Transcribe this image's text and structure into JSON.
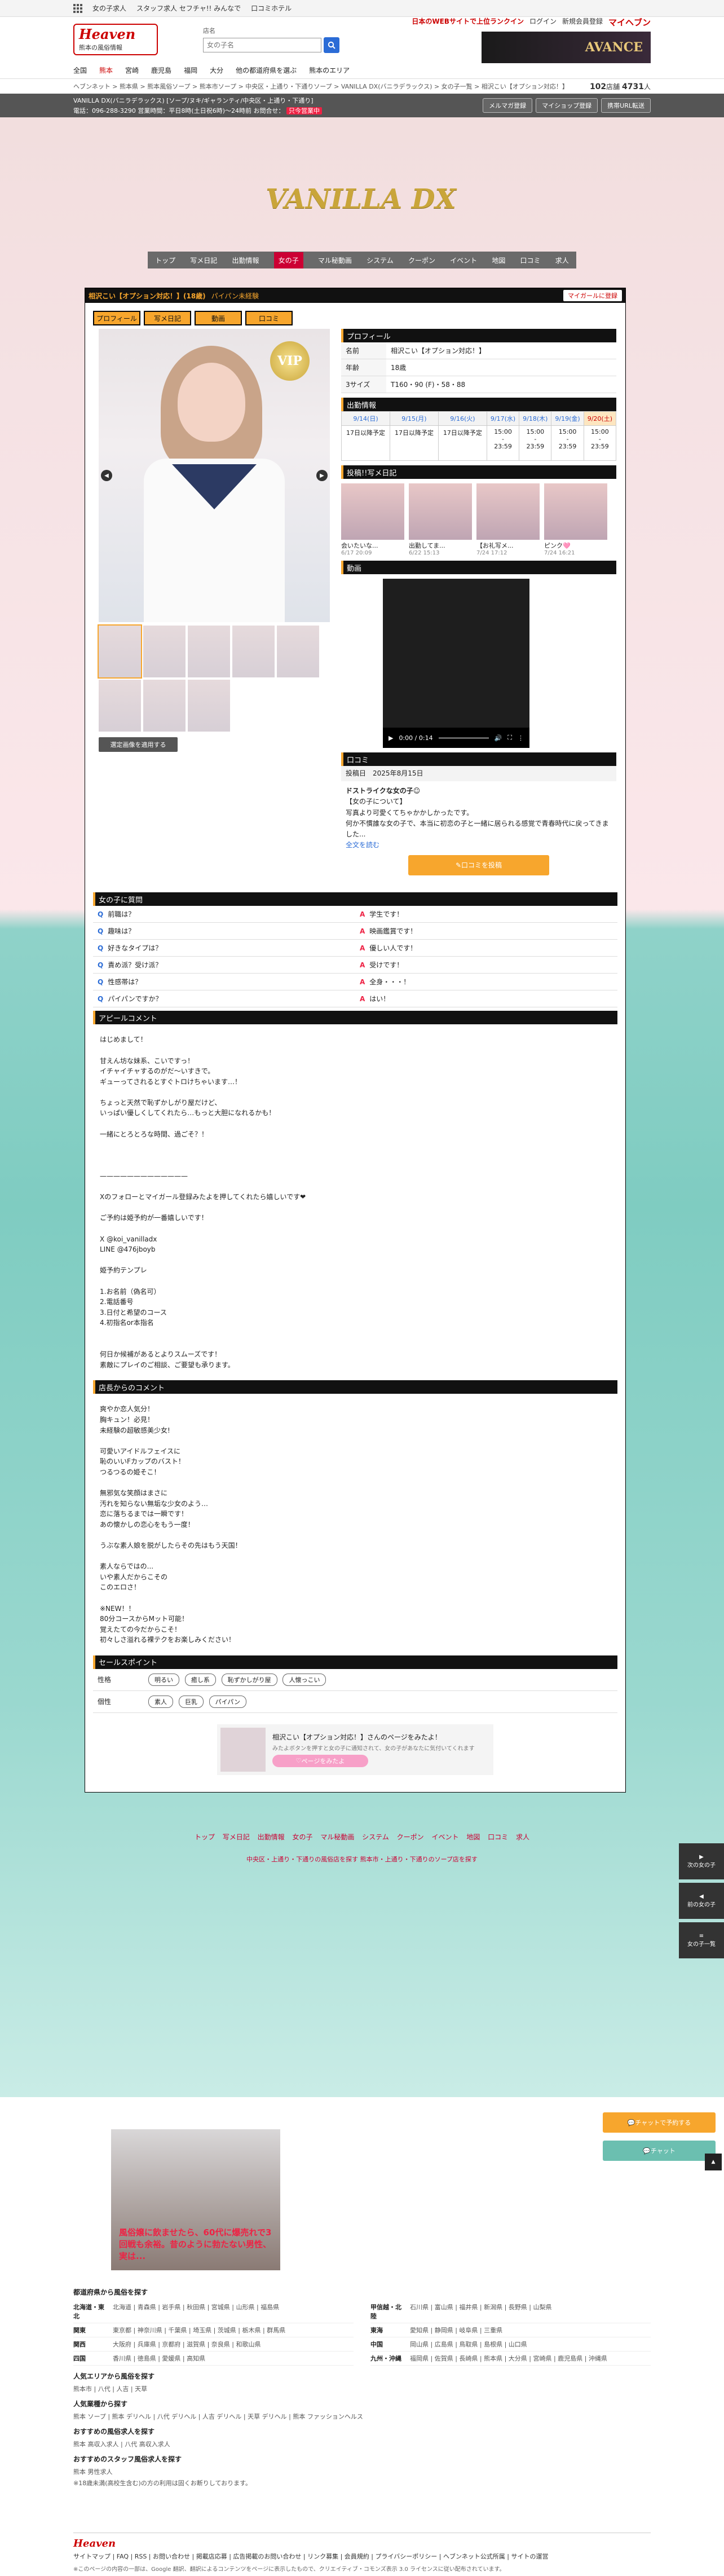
{
  "topbar": [
    "女の子求人",
    "スタッフ求人 セフチャ!! みんなで",
    "口コミホテル"
  ],
  "header": {
    "logo_main": "Heaven",
    "logo_area": "熊本の風俗情報",
    "search_label": "店名",
    "search_placeholder": "女の子名",
    "links": [
      "日本のWEBサイトで上位ランクイン",
      "ログイン",
      "新規会員登録"
    ],
    "my_heaven": "マイヘブン",
    "banner_text": "AVANCE"
  },
  "region_nav": [
    "全国",
    "熊本",
    "宮崎",
    "鹿児島",
    "福岡",
    "大分",
    "他の都道府県を選ぶ",
    "熊本のエリア"
  ],
  "breadcrumb": "ヘブンネット > 熊本県 > 熊本風俗ソープ > 熊本市ソープ > 中央区・上通り・下通りソープ > VANILLA DX(バニラデラックス) > 女の子一覧 > 相沢こい【オプション対応！】",
  "counts": {
    "shops": "102",
    "shops_unit": "店舗",
    "girls": "4731",
    "girls_unit": "人"
  },
  "shopbar": {
    "line1": "VANILLA DX(バニラデラックス) [ソープ/ヌキ/ギャランティ/中央区・上通り・下通り]",
    "line2": "電話：096-288-3290 営業時間：平日8時(土日祝6時)〜24時前 お問合せ：",
    "open_label": "只今営業中",
    "buttons": [
      "メルマガ登録",
      "マイショップ登録",
      "携帯URL転送"
    ]
  },
  "brand": "VANILLA DX",
  "shop_menu": [
    "トップ",
    "写メ日記",
    "出勤情報",
    "女の子",
    "マル秘動画",
    "システム",
    "クーポン",
    "イベント",
    "地図",
    "口コミ",
    "求人"
  ],
  "shop_menu_active": "女の子",
  "girl": {
    "name": "相沢こい【オプション対応！】(18歳)",
    "tag": "パイパン未経験",
    "fav": "マイガールに登録",
    "tabs": [
      "プロフィール",
      "写メ日記",
      "動画",
      "口コミ"
    ],
    "vip": "VIP",
    "apply": "選定画像を適用する"
  },
  "profile": {
    "title": "プロフィール",
    "rows": [
      {
        "k": "名前",
        "v": "相沢こい【オプション対応！】"
      },
      {
        "k": "年齢",
        "v": "18歳"
      },
      {
        "k": "3サイズ",
        "v": "T160・90 (F)・58・88"
      }
    ]
  },
  "schedule": {
    "title": "出勤情報",
    "days": [
      "9/14(日)",
      "9/15(月)",
      "9/16(火)",
      "9/17(水)",
      "9/18(木)",
      "9/19(金)",
      "9/20(土)"
    ],
    "times": [
      "17日以降予定",
      "17日以降予定",
      "17日以降予定",
      "15:00\n-\n23:59",
      "15:00\n-\n23:59",
      "15:00\n-\n23:59",
      "15:00\n-\n23:59"
    ]
  },
  "diary": {
    "title": "投稿!!写メ日記",
    "items": [
      {
        "cap": "会いたいな...",
        "date": "6/17 20:09"
      },
      {
        "cap": "出勤してま...",
        "date": "6/22 15:13"
      },
      {
        "cap": "【お礼写メ...",
        "date": "7/24 17:12"
      },
      {
        "cap": "ピンク🩷",
        "date": "7/24 16:21"
      }
    ]
  },
  "video": {
    "title": "動画",
    "time": "0:00 / 0:14"
  },
  "review": {
    "title": "口コミ",
    "date_label": "投稿日",
    "date": "2025年8月15日",
    "headline": "ドストライクな女の子☺",
    "subhead": "【女の子について】",
    "body": "写真より可愛くてちゃかかしかったです。\n何か不慣誰な女の子で、本当に初恋の子と一緒に居られる感覚で青春時代に戻ってきました...",
    "more": "全文を読む",
    "button": "口コミを投稿"
  },
  "qa": {
    "title": "女の子に質問",
    "items": [
      {
        "q": "前職は？",
        "a": "学生です！"
      },
      {
        "q": "趣味は？",
        "a": "映画鑑賞です！"
      },
      {
        "q": "好きなタイプは？",
        "a": "優しい人です！"
      },
      {
        "q": "責め派？受け派？",
        "a": "受けです！"
      },
      {
        "q": "性感帯は？",
        "a": "全身・・・！"
      },
      {
        "q": "パイパンですか？",
        "a": "はい！"
      }
    ]
  },
  "appeal": {
    "title": "アピールコメント",
    "body": "はじめまして！\n\n甘えん坊な妹系、こいですっ！\nイチャイチャするのがだ〜いすきで。\nギューってされるとすぐトロけちゃいます…！\n\nちょっと天然で恥ずかしがり屋だけど、\nいっぱい優しくしてくれたら…もっと大胆になれるかも！\n\n一緒にとろとろな時間、過ごそ？！\n\n\n\n—————————————\n\nXのフォローとマイガール登録みたよを押してくれたら嬉しいです❤\n\nご予約は姫予約が一番嬉しいです！\n\nX @koi_vanilladx\nLINE @476jboyb\n\n姫予約テンプレ\n\n1.お名前（偽名可）\n2.電話番号\n3.日付と希望のコース\n4.初指名or本指名\n\n\n何日か候補があるとよりスムーズです！\n素敵にプレイのご相談、ご要望も承ります。"
  },
  "staff": {
    "title": "店長からのコメント",
    "body": "爽やか恋人気分！\n胸キュン！必見！\n未経験の超敏感美少女!\n\n可愛いアイドルフェイスに\n恥のいいFカップのバスト！\nつるつるの姫そこ！\n\n無邪気な笑顔はまさに\n汚れを知らない無垢な少女のよう…\n恋に落ちるまでは一瞬です！\nあの懐かしの恋心をもう一度！\n\nうぶな素人娘を脱がしたらその先はもう天国！\n\n素人ならではの...\nいや素人だからこその\nこのエロさ！\n\n※NEW！！\n80分コースからMット可能！\n覚えたての今だからこそ！\n初々しさ溢れる裸テクをお楽しみください！"
  },
  "sales": {
    "title": "セールスポイント",
    "rows": [
      {
        "k": "性格",
        "chips": [
          "明るい",
          "癒し系",
          "恥ずかしがり屋",
          "人懐っこい"
        ]
      },
      {
        "k": "個性",
        "chips": [
          "素人",
          "巨乳",
          "パイパン"
        ]
      }
    ]
  },
  "cta": {
    "msg": "相沢こい【オプション対応！】さんのページをみたよ！",
    "sub": "みたよボタンを押すと女の子に通知されて、女の子があなたに気付いてくれます",
    "button": "ページをみたよ"
  },
  "foot_menu": [
    "トップ",
    "写メ日記",
    "出勤情報",
    "女の子",
    "マル秘動画",
    "システム",
    "クーポン",
    "イベント",
    "地図",
    "口コミ",
    "求人"
  ],
  "foot_sub": "中央区・上通り・下通りの風俗店を探す    熊本市・上通り・下通りのソープ店を探す",
  "side": [
    {
      "label": "次の女の子"
    },
    {
      "label": "前の女の子"
    },
    {
      "label": "女の子一覧"
    }
  ],
  "chat_buttons": [
    "チャットで予約する",
    "チャット"
  ],
  "ad_text": "風俗嬢に飲ませたら、60代に爆売れで3回戦も余裕。昔のように勃たない男性、実は...",
  "areas": {
    "title": "都道府県から風俗を探す",
    "rows": [
      {
        "n": "北海道・東北",
        "v": "北海道 | 青森県 | 岩手県 | 秋田県 | 宮城県 | 山形県 | 福島県"
      },
      {
        "n": "甲信越・北陸",
        "v": "石川県 | 富山県 | 福井県 | 新潟県 | 長野県 | 山梨県"
      },
      {
        "n": "関東",
        "v": "東京都 | 神奈川県 | 千葉県 | 埼玉県 | 茨城県 | 栃木県 | 群馬県"
      },
      {
        "n": "東海",
        "v": "愛知県 | 静岡県 | 岐阜県 | 三重県"
      },
      {
        "n": "関西",
        "v": "大阪府 | 兵庫県 | 京都府 | 滋賀県 | 奈良県 | 和歌山県"
      },
      {
        "n": "中国",
        "v": "岡山県 | 広島県 | 鳥取県 | 島根県 | 山口県"
      },
      {
        "n": "四国",
        "v": "香川県 | 徳島県 | 愛媛県 | 高知県"
      },
      {
        "n": "九州・沖縄",
        "v": "福岡県 | 佐賀県 | 長崎県 | 熊本県 | 大分県 | 宮崎県 | 鹿児島県 | 沖縄県"
      }
    ],
    "pop_title": "人気エリアから風俗を探す",
    "pop": "熊本市 | 八代 | 人吉 | 天草",
    "type_title": "人気業種から探す",
    "types": "熊本 ソープ | 熊本 デリヘル | 八代 デリヘル | 人吉 デリヘル | 天草 デリヘル | 熊本 ファッションヘルス",
    "shop_title": "おすすめの風俗求人を探す",
    "shops": "熊本 高収入求人 | 八代 高収入求人",
    "staff_title": "おすすめのスタッフ風俗求人を探す",
    "staff": "熊本 男性求人",
    "notice": "※18歳未満(高校生含む)の方の利用は固くお断りしております。"
  },
  "footer": {
    "logo": "Heaven",
    "links": "サイトマップ | FAQ | RSS | お問い合わせ | 掲載店応募 | 広告掲載のお問い合わせ | リンク募集 | 会員規約 | プライバシーポリシー | ヘブンネット公式所属 | サイトの運営",
    "copyright": "※このページの内容の一部は、Google 翻訳、翻訳によるコンテンツをページに表示したもので、クリエイティブ・コモンズ表示 3.0 ライセンスに従い配布されています。"
  }
}
